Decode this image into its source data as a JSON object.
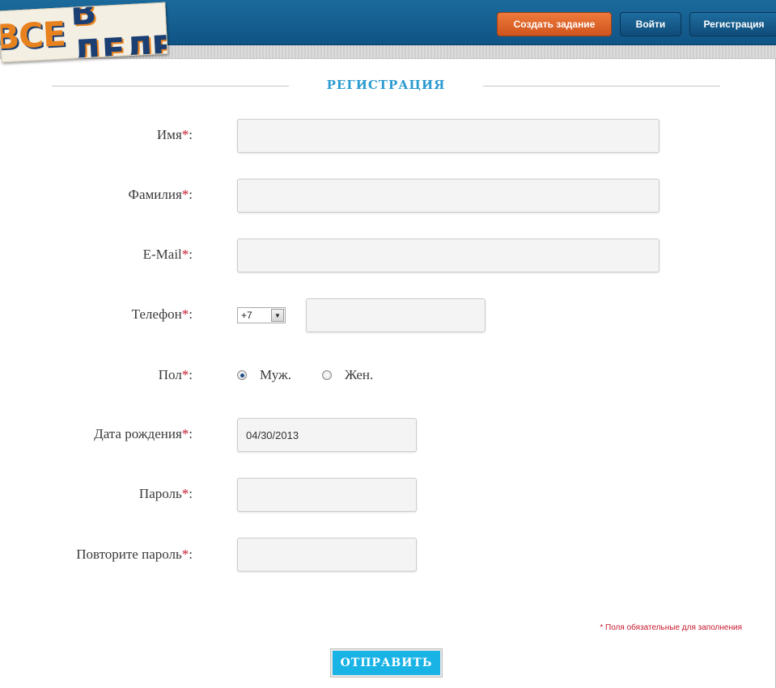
{
  "header": {
    "logo_word1": "ВСЕ",
    "logo_word2": "В ДЕЛЕ",
    "create_task_label": "Создать задание",
    "login_label": "Войти",
    "register_label": "Регистрация"
  },
  "form": {
    "title": "РЕГИСТРАЦИЯ",
    "required_mark": "*",
    "label_suffix": ":",
    "fields": {
      "first_name": {
        "label": "Имя",
        "value": ""
      },
      "last_name": {
        "label": "Фамилия",
        "value": ""
      },
      "email": {
        "label": "E-Mail",
        "value": ""
      },
      "phone": {
        "label": "Телефон",
        "country_code": "+7",
        "value": ""
      },
      "gender": {
        "label": "Пол",
        "options": [
          "Муж.",
          "Жен."
        ],
        "selected": "Муж."
      },
      "birth_date": {
        "label": "Дата рождения",
        "value": "04/30/2013"
      },
      "password": {
        "label": "Пароль",
        "value": ""
      },
      "password_repeat": {
        "label": "Повторите пароль",
        "value": ""
      }
    },
    "required_note": "* Поля обязательные для заполнения",
    "submit_label": "ОТПРАВИТЬ"
  },
  "colors": {
    "header_blue": "#0f5485",
    "accent_orange": "#cf541d",
    "title_blue": "#2a9bd1",
    "required_red": "#c8192e",
    "submit_blue": "#19b3e6"
  }
}
